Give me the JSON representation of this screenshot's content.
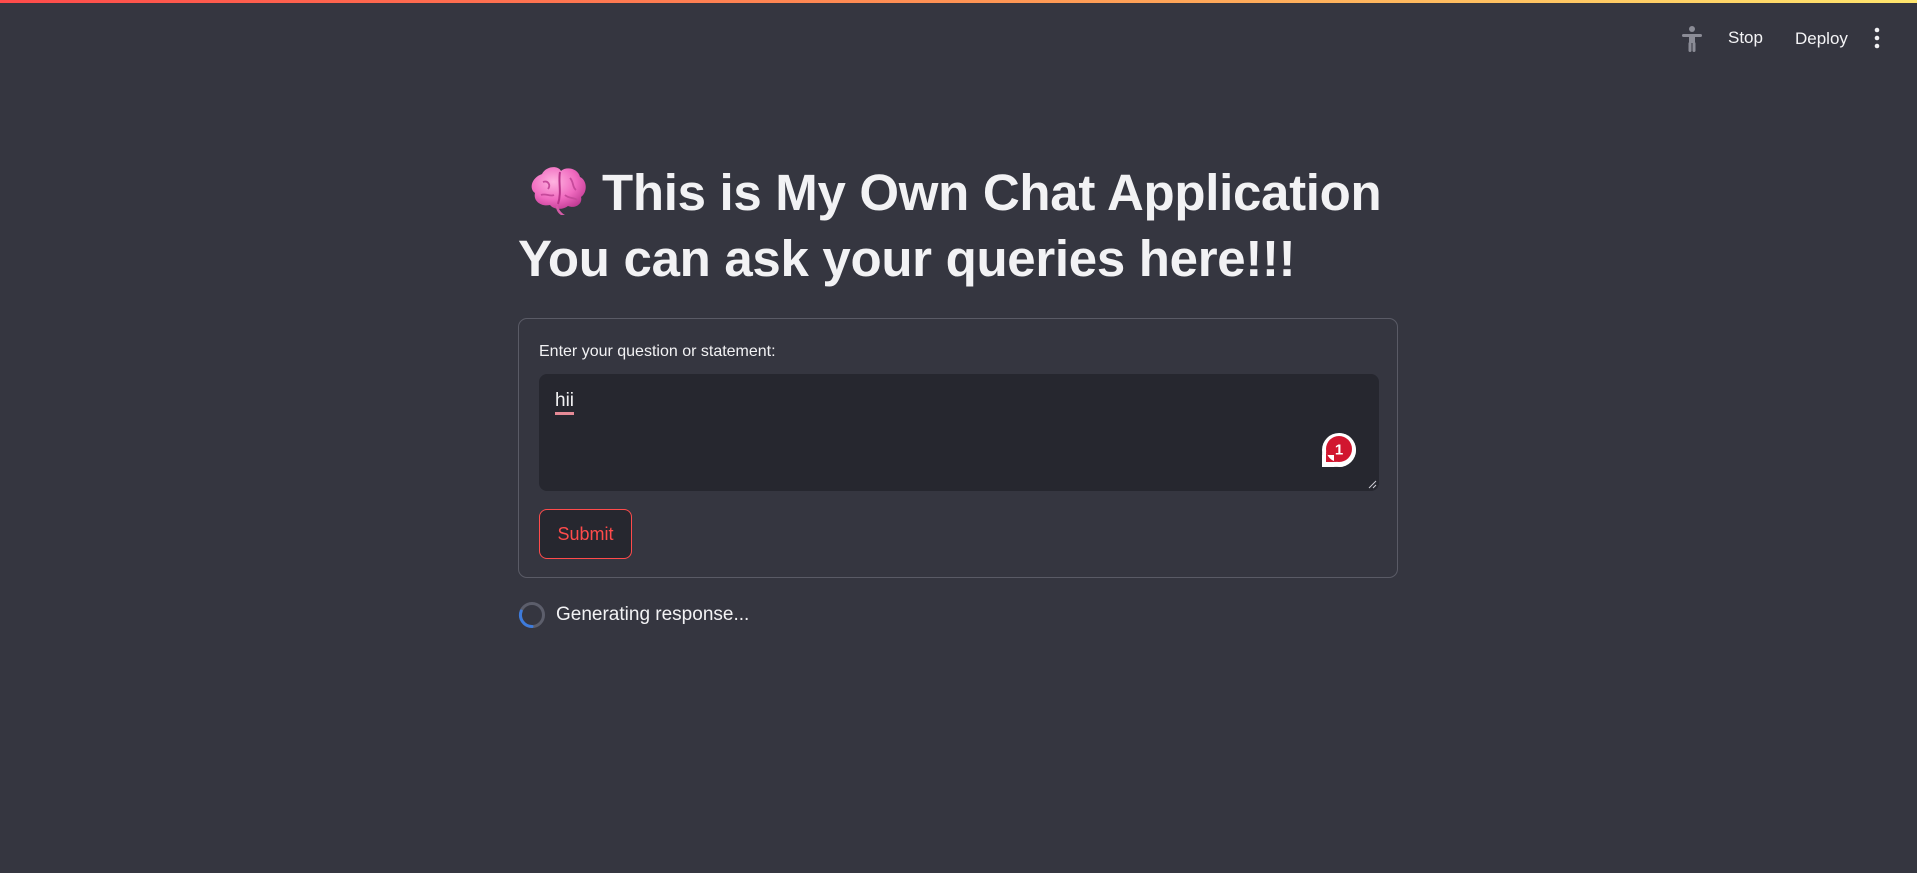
{
  "header": {
    "stop_label": "Stop",
    "deploy_label": "Deploy",
    "icons": [
      "accessibility-icon",
      "more-vertical-icon"
    ]
  },
  "main": {
    "title_icon": "brain-icon",
    "title_line1": "This is My Own Chat Application",
    "title_line2": "You can ask your queries here!!!"
  },
  "form": {
    "label": "Enter your question or statement:",
    "value": "hii",
    "notification_count": "1",
    "submit_label": "Submit"
  },
  "status": {
    "text": "Generating response..."
  },
  "colors": {
    "background": "#353640",
    "input_background": "#26272f",
    "accent": "#ff4b4b",
    "badge": "#d1162f"
  }
}
